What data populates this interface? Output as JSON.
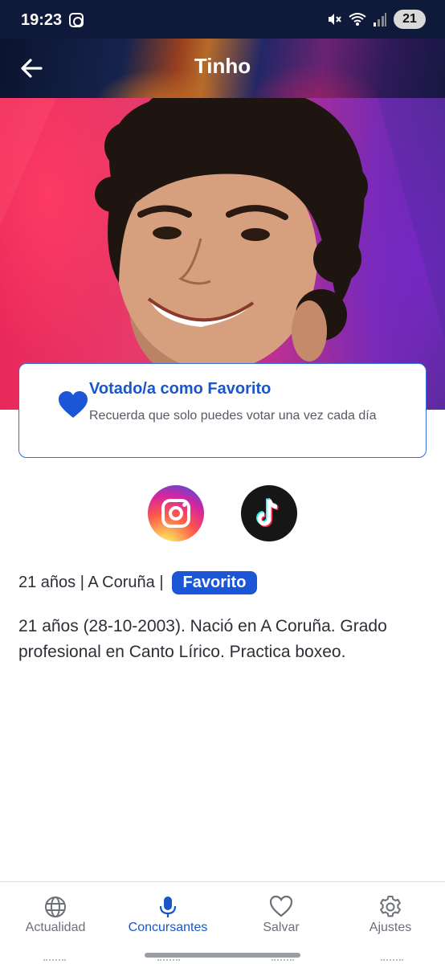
{
  "status_bar": {
    "time": "19:23",
    "battery": "21",
    "icons": [
      "instagram-notification-icon",
      "mute-icon",
      "wifi-icon",
      "signal-icon",
      "battery-icon"
    ]
  },
  "header": {
    "title": "Tinho",
    "back_icon": "arrow-left-icon"
  },
  "favorite_card": {
    "icon": "heart-fill-icon",
    "title": "Votado/a como Favorito",
    "subtitle": "Recuerda que solo puedes votar una vez cada día"
  },
  "social": [
    {
      "name": "Instagram",
      "icon": "instagram-icon"
    },
    {
      "name": "TikTok",
      "icon": "tiktok-icon"
    }
  ],
  "info": {
    "summary": "21 años | A Coruña |",
    "badge": "Favorito",
    "bio": "21 años (28-10-2003). Nació en A Coruña. Grado profesional en Canto Lírico. Practica boxeo."
  },
  "bottom_nav": {
    "items": [
      {
        "label": "Actualidad",
        "icon": "globe-icon",
        "active": false
      },
      {
        "label": "Concursantes",
        "icon": "microphone-icon",
        "active": true
      },
      {
        "label": "Salvar",
        "icon": "heart-outline-icon",
        "active": false
      },
      {
        "label": "Ajustes",
        "icon": "gear-icon",
        "active": false
      }
    ]
  },
  "colors": {
    "accent": "#1a56c8",
    "badge": "#1a56d6",
    "status_bar": "#0f1a3a",
    "hero_left": "#e8285a",
    "hero_right": "#5a2a9a"
  }
}
